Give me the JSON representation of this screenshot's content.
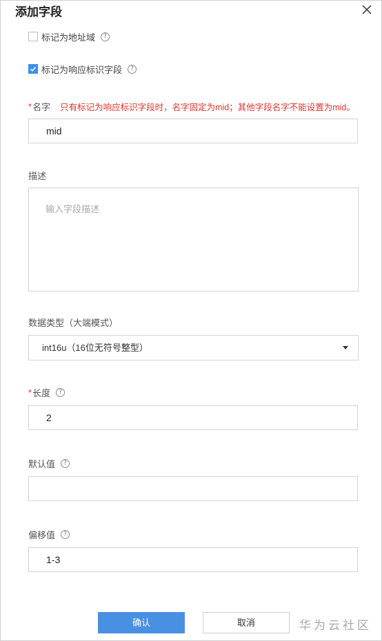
{
  "dialog": {
    "title": "添加字段",
    "close_icon": "close-icon"
  },
  "options": {
    "address_field": {
      "label": "标记为地址域",
      "checked": false,
      "help": "?"
    },
    "response_id_field": {
      "label": "标记为响应标识字段",
      "checked": true,
      "help": "?"
    }
  },
  "form": {
    "name": {
      "required_mark": "*",
      "label": "名字",
      "warning": "只有标记为响应标识字段时，名字固定为mid；其他字段名字不能设置为mid。",
      "value": "mid"
    },
    "description": {
      "label": "描述",
      "placeholder": "输入字段描述",
      "value": ""
    },
    "data_type": {
      "label": "数据类型（大端模式）",
      "selected": "int16u（16位无符号整型）"
    },
    "length": {
      "required_mark": "*",
      "label": "长度",
      "help": "?",
      "value": "2"
    },
    "default_value": {
      "label": "默认值",
      "help": "?",
      "value": ""
    },
    "offset": {
      "label": "偏移值",
      "help": "?",
      "value": "1-3"
    }
  },
  "footer": {
    "confirm_label": "确认",
    "cancel_label": "取消"
  },
  "watermark": "华为云社区",
  "colors": {
    "accent": "#4a90e2",
    "required": "#e0342d",
    "checkbox_checked": "#3b8ff0"
  }
}
